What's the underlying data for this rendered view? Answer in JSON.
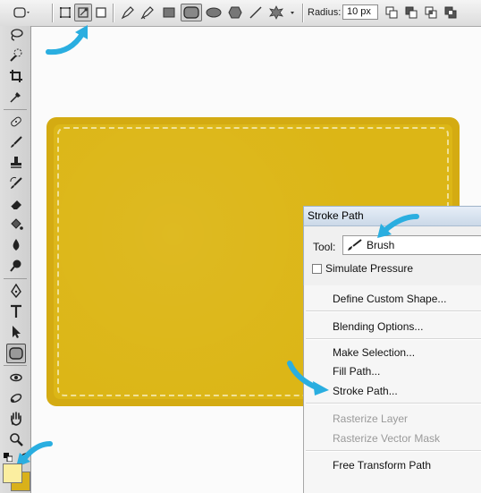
{
  "options_bar": {
    "radius_label": "Radius:",
    "radius_value": "10 px",
    "icons": [
      "rounded-rect-tool-preset-icon",
      "shape-layers-icon",
      "paths-icon",
      "fill-pixels-icon",
      "pen-icon",
      "freeform-pen-icon",
      "rectangle-icon",
      "rounded-rectangle-icon",
      "ellipse-icon",
      "polygon-icon",
      "line-icon",
      "custom-shape-icon",
      "add-to-area-icon",
      "subtract-icon",
      "intersect-icon",
      "exclude-icon"
    ]
  },
  "tools_panel": {
    "icons": [
      "lasso-icon",
      "quick-selection-icon",
      "crop-icon",
      "eyedropper-icon",
      "healing-brush-icon",
      "brush-icon",
      "clone-stamp-icon",
      "history-brush-icon",
      "eraser-icon",
      "paint-bucket-icon",
      "blur-icon",
      "dodge-icon",
      "pen-icon",
      "type-icon",
      "path-selection-icon",
      "rounded-rectangle-icon",
      "3d-rotate-icon",
      "3d-orbit-icon",
      "hand-icon",
      "zoom-icon"
    ],
    "foreground_color": "#fbeea0",
    "background_color": "#d9b11a"
  },
  "canvas": {
    "shape_color": "#d4ab12",
    "stitch_color": "#f3e6a6"
  },
  "stroke_dialog": {
    "title": "Stroke Path",
    "tool_label": "Tool:",
    "tool_value": "Brush",
    "simulate_pressure": "Simulate Pressure"
  },
  "context_menu": {
    "define_custom_shape": "Define Custom Shape...",
    "blending_options": "Blending Options...",
    "make_selection": "Make Selection...",
    "fill_path": "Fill Path...",
    "stroke_path": "Stroke Path...",
    "rasterize_layer": "Rasterize Layer",
    "rasterize_vector_mask": "Rasterize Vector Mask",
    "free_transform_path": "Free Transform Path"
  },
  "accent": {
    "arrow_color": "#2aaee0"
  }
}
